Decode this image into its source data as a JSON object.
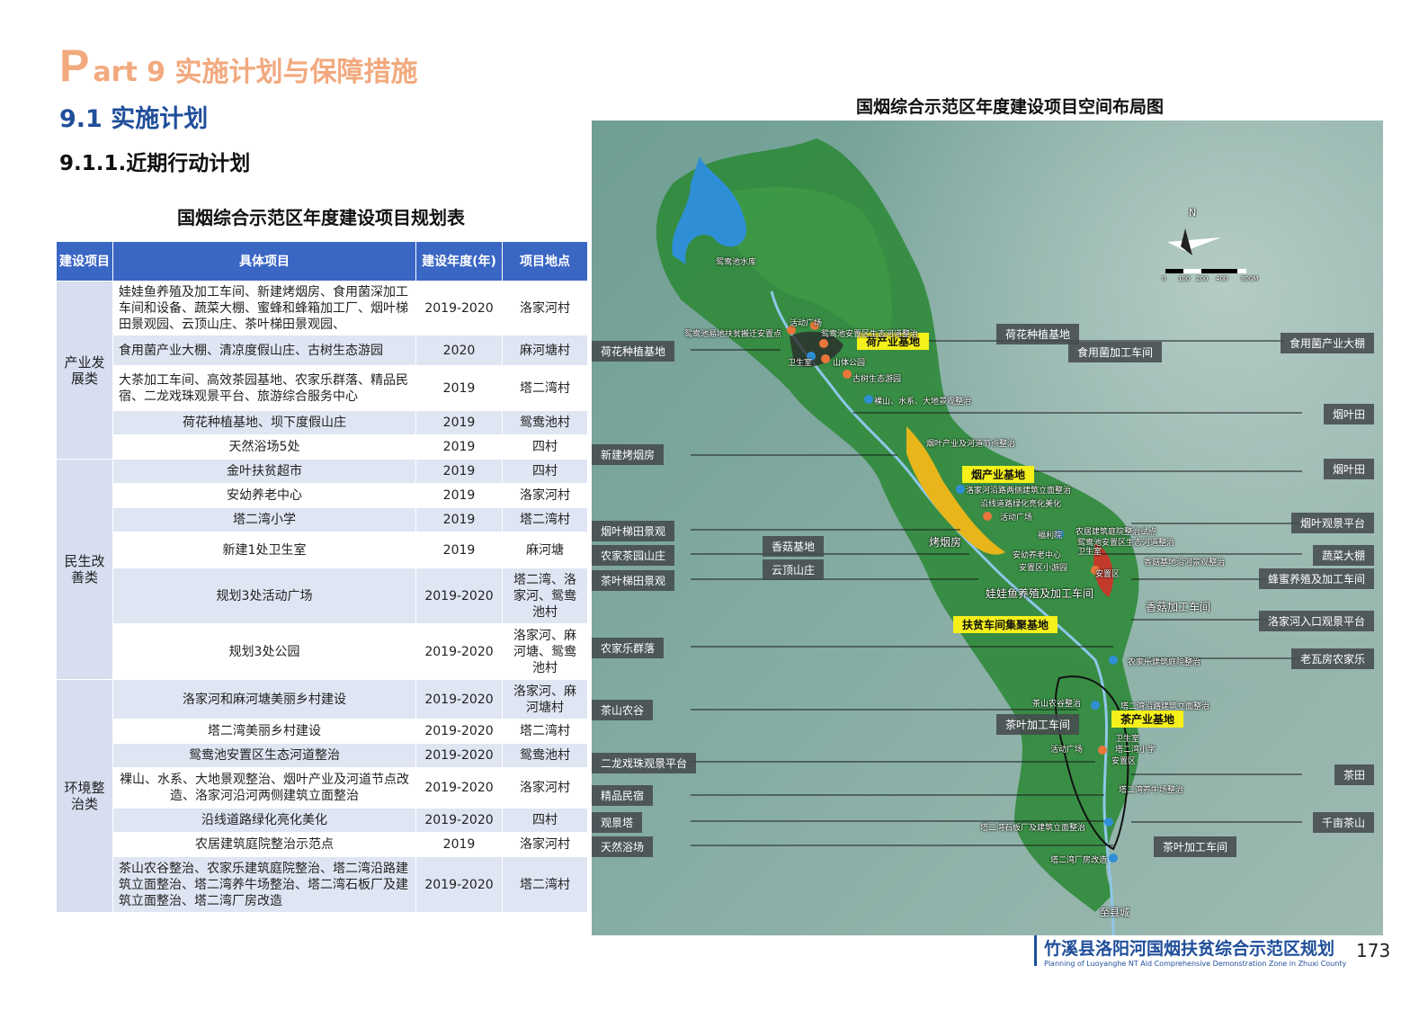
{
  "header": {
    "part_letter": "P",
    "part_rest": "art 9 实施计划与保障措施",
    "section": "9.1 实施计划",
    "subsection": "9.1.1.近期行动计划"
  },
  "table": {
    "title": "国烟综合示范区年度建设项目规划表",
    "headers": [
      "建设项目",
      "具体项目",
      "建设年度(年)",
      "项目地点"
    ],
    "categories": [
      "产业发展类",
      "民生改善类",
      "环境整治类"
    ],
    "rows": [
      {
        "item": "娃娃鱼养殖及加工车间、新建烤烟房、食用菌深加工车间和设备、蔬菜大棚、蜜蜂和蜂箱加工厂、烟叶梯田景观园、云顶山庄、茶叶梯田景观园、",
        "year": "2019-2020",
        "loc": "洛家河村"
      },
      {
        "item": "食用菌产业大棚、清凉度假山庄、古树生态游园",
        "year": "2020",
        "loc": "麻河塘村"
      },
      {
        "item": "大茶加工车间、高效茶园基地、农家乐群落、精品民宿、二龙戏珠观景平台、旅游综合服务中心",
        "year": "2019",
        "loc": "塔二湾村"
      },
      {
        "item": "荷花种植基地、坝下度假山庄",
        "year": "2019",
        "loc": "鸳鸯池村"
      },
      {
        "item": "天然浴场5处",
        "year": "2019",
        "loc": "四村"
      },
      {
        "item": "金叶扶贫超市",
        "year": "2019",
        "loc": "四村"
      },
      {
        "item": "安幼养老中心",
        "year": "2019",
        "loc": "洛家河村"
      },
      {
        "item": "塔二湾小学",
        "year": "2019",
        "loc": "塔二湾村"
      },
      {
        "item": "新建1处卫生室",
        "year": "2019",
        "loc": "麻河塘"
      },
      {
        "item": "规划3处活动广场",
        "year": "2019-2020",
        "loc": "塔二湾、洛家河、鸳鸯池村"
      },
      {
        "item": "规划3处公园",
        "year": "2019-2020",
        "loc": "洛家河、麻河塘、鸳鸯池村"
      },
      {
        "item": "洛家河和麻河塘美丽乡村建设",
        "year": "2019-2020",
        "loc": "洛家河、麻河塘村"
      },
      {
        "item": "塔二湾美丽乡村建设",
        "year": "2019-2020",
        "loc": "塔二湾村"
      },
      {
        "item": "鸳鸯池安置区生态河道整治",
        "year": "2019-2020",
        "loc": "鸳鸯池村"
      },
      {
        "item": "裸山、水系、大地景观整治、烟叶产业及河道节点改造、洛家河沿河两侧建筑立面整治",
        "year": "2019-2020",
        "loc": "洛家河村"
      },
      {
        "item": "沿线道路绿化亮化美化",
        "year": "2019-2020",
        "loc": "四村"
      },
      {
        "item": "农居建筑庭院整治示范点",
        "year": "2019",
        "loc": "洛家河村"
      },
      {
        "item": "茶山农谷整治、农家乐建筑庭院整治、塔二湾沿路建筑立面整治、塔二湾养牛场整治、塔二湾石板厂及建筑立面整治、塔二湾厂房改造",
        "year": "2019-2020",
        "loc": "塔二湾村"
      }
    ]
  },
  "map": {
    "title": "国烟综合示范区年度建设项目空间布局图",
    "north": "N",
    "scale_ticks": [
      "0",
      "100",
      "200",
      "400",
      "800M"
    ],
    "reservoir_label": "鸳鸯池水库",
    "to_county": "至县城",
    "yellow_labels": [
      "荷产业基地",
      "烟产业基地",
      "扶贫车间集聚基地",
      "茶产业基地"
    ],
    "left_labels": [
      "荷花种植基地",
      "新建烤烟房",
      "烟叶梯田景观",
      "农家茶园山庄",
      "茶叶梯田景观",
      "农家乐群落",
      "茶山农谷",
      "二龙戏珠观景平台",
      "精品民宿",
      "观景塔",
      "天然浴场"
    ],
    "right_labels": [
      "食用菌产业大棚",
      "烟叶田",
      "烟叶田",
      "烟叶观景平台",
      "蔬菜大棚",
      "蜂蜜养殖及加工车间",
      "洛家河入口观景平台",
      "老瓦房农家乐",
      "茶田",
      "千亩茶山"
    ],
    "mid_labels": [
      "荷花种植基地",
      "食用菌加工车间",
      "香菇基地",
      "云顶山庄",
      "烤烟房",
      "娃娃鱼养殖及加工车间",
      "香菇加工车间",
      "茶叶加工车间",
      "茶叶加工车间"
    ],
    "small_labels": [
      "鸳鸯池易地扶贫搬迁安置点",
      "活动广场",
      "鸳鸯池安置区生态河道整治",
      "卫生室",
      "山体公园",
      "古树生态游园",
      "裸山、水系、大地景观整治",
      "烟叶产业及河道节点整治",
      "洛家河沿路两侧建筑立面整治",
      "沿线道路绿化亮化美化",
      "活动广场",
      "农居建筑庭院整治试点",
      "福利院",
      "鸳鸯池安置区生态河道整治",
      "安幼养老中心",
      "卫生室",
      "安置区小游园",
      "安置区",
      "香菇基地沿河景观整治",
      "农家乐建筑庭院整治",
      "茶山农谷整治",
      "塔二湾沿路建筑立面整治",
      "活动广场",
      "卫生室",
      "塔二湾小学",
      "安置区",
      "塔二湾养牛场整治",
      "塔二湾石板厂及建筑立面整治",
      "塔二湾厂房改造"
    ]
  },
  "footer": {
    "title_cn": "竹溪县洛阳河国烟扶贫综合示范区规划",
    "title_en": "Planning of Luoyanghe NT Aid Comprehensive Demonstration Zone in Zhuxi County",
    "page": "173"
  }
}
